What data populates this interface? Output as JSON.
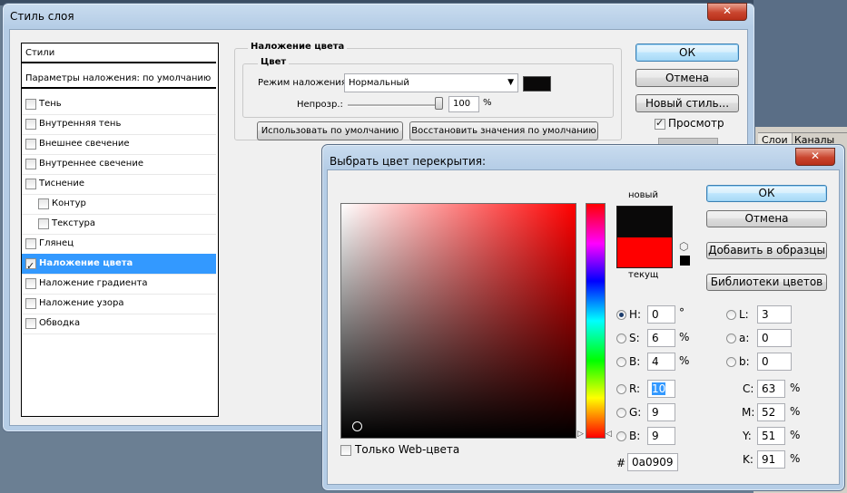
{
  "background": {
    "layers_tabs": [
      "Слои",
      "Каналы"
    ]
  },
  "layer_style_dialog": {
    "title": "Стиль слоя",
    "close_label": "✕",
    "styles_header": "Стили",
    "blend_defaults": "Параметры наложения: по умолчанию",
    "items": [
      {
        "label": "Тень",
        "checked": false,
        "indent": false
      },
      {
        "label": "Внутренняя тень",
        "checked": false,
        "indent": false
      },
      {
        "label": "Внешнее свечение",
        "checked": false,
        "indent": false
      },
      {
        "label": "Внутреннее свечение",
        "checked": false,
        "indent": false
      },
      {
        "label": "Тиснение",
        "checked": false,
        "indent": false
      },
      {
        "label": "Контур",
        "checked": false,
        "indent": true
      },
      {
        "label": "Текстура",
        "checked": false,
        "indent": true
      },
      {
        "label": "Глянец",
        "checked": false,
        "indent": false
      },
      {
        "label": "Наложение цвета",
        "checked": true,
        "indent": false,
        "selected": true
      },
      {
        "label": "Наложение градиента",
        "checked": false,
        "indent": false
      },
      {
        "label": "Наложение узора",
        "checked": false,
        "indent": false
      },
      {
        "label": "Обводка",
        "checked": false,
        "indent": false
      }
    ],
    "section_title": "Наложение цвета",
    "color_group": "Цвет",
    "blend_mode_label": "Режим наложения:",
    "blend_mode_value": "Нормальный",
    "overlay_color": "#0a0909",
    "opacity_label": "Непрозр.:",
    "opacity_value": "100",
    "opacity_unit": "%",
    "opacity_level": 1.0,
    "use_default": "Использовать по умолчанию",
    "restore_default": "Восстановить значения по умолчанию",
    "ok": "ОК",
    "cancel": "Отмена",
    "new_style": "Новый стиль...",
    "preview_label": "Просмотр",
    "preview_checked": true
  },
  "color_picker": {
    "title": "Выбрать цвет перекрытия:",
    "close_label": "✕",
    "new_label": "новый",
    "current_label": "текущ",
    "new_color": "#0a0909",
    "current_color": "#ff0000",
    "ok": "ОК",
    "cancel": "Отмена",
    "add_swatches": "Добавить в образцы",
    "color_libraries": "Библиотеки цветов",
    "hsb": {
      "h_label": "H:",
      "h_value": "0",
      "h_unit": "°",
      "s_label": "S:",
      "s_value": "6",
      "s_unit": "%",
      "b_label": "B:",
      "b_value": "4",
      "b_unit": "%"
    },
    "rgb": {
      "r_label": "R:",
      "r_value": "10",
      "g_label": "G:",
      "g_value": "9",
      "b_label": "B:",
      "b_value": "9"
    },
    "hex_label": "#",
    "hex_value": "0a0909",
    "lab": {
      "l_label": "L:",
      "l_value": "3",
      "a_label": "a:",
      "a_value": "0",
      "b_label": "b:",
      "b_value": "0"
    },
    "cmyk": {
      "c_label": "C:",
      "c_value": "63",
      "m_label": "M:",
      "m_value": "52",
      "y_label": "Y:",
      "y_value": "51",
      "k_label": "K:",
      "k_value": "91",
      "unit": "%"
    },
    "web_only_label": "Только Web-цвета",
    "web_only_checked": false,
    "selected_mode": "H",
    "field_hue_color": "#ff0000"
  }
}
